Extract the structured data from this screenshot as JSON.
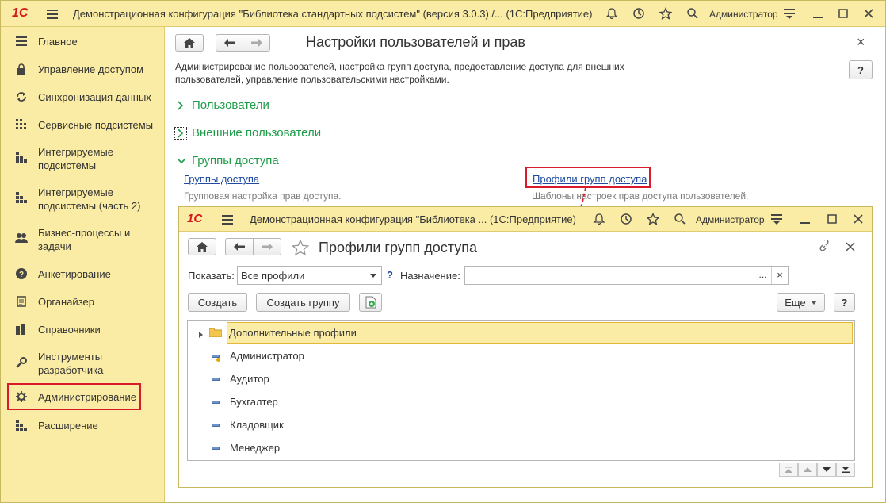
{
  "app": {
    "logo": "1С",
    "title": "Демонстрационная конфигурация \"Библиотека стандартных подсистем\" (версия 3.0.3) /...  (1С:Предприятие)",
    "user": "Администратор"
  },
  "sidebar": {
    "items": [
      {
        "label": "Главное",
        "icon": "menu-icon"
      },
      {
        "label": "Управление доступом",
        "icon": "lock-icon"
      },
      {
        "label": "Синхронизация данных",
        "icon": "sync-icon"
      },
      {
        "label": "Сервисные подсистемы",
        "icon": "grid-icon"
      },
      {
        "label": "Интегрируемые подсистемы",
        "icon": "blocks-icon"
      },
      {
        "label": "Интегрируемые подсистемы (часть 2)",
        "icon": "blocks-icon"
      },
      {
        "label": "Бизнес-процессы и задачи",
        "icon": "people-icon"
      },
      {
        "label": "Анкетирование",
        "icon": "question-icon"
      },
      {
        "label": "Органайзер",
        "icon": "notepad-icon"
      },
      {
        "label": "Справочники",
        "icon": "books-icon"
      },
      {
        "label": "Инструменты разработчика",
        "icon": "wrench-icon"
      },
      {
        "label": "Администрирование",
        "icon": "gear-icon"
      },
      {
        "label": "Расширение",
        "icon": "blocks-icon"
      }
    ]
  },
  "main": {
    "title": "Настройки пользователей и прав",
    "description": "Администрирование пользователей, настройка групп доступа, предоставление доступа для внешних пользователей, управление пользовательскими настройками.",
    "help": "?",
    "close": "×",
    "groups": [
      {
        "label": "Пользователи"
      },
      {
        "label": "Внешние пользователи"
      },
      {
        "label": "Группы доступа"
      }
    ],
    "links": [
      {
        "label": "Группы доступа",
        "hint": "Групповая настройка прав доступа."
      },
      {
        "label": "Профили групп доступа",
        "hint": "Шаблоны настроек прав доступа пользователей."
      }
    ]
  },
  "subwindow": {
    "title": "Демонстрационная конфигурация \"Библиотека ...  (1С:Предприятие)",
    "user": "Администратор",
    "form_title": "Профили групп доступа",
    "show_label": "Показать:",
    "show_value": "Все профили",
    "purpose_label": "Назначение:",
    "purpose_value": "",
    "help_mark": "?",
    "buttons": {
      "create": "Создать",
      "create_group": "Создать группу",
      "more": "Еще",
      "help": "?",
      "pick": "...",
      "clear": "×"
    },
    "rows": [
      {
        "label": "Дополнительные профили",
        "type": "folder"
      },
      {
        "label": "Администратор",
        "type": "admin"
      },
      {
        "label": "Аудитор",
        "type": "item"
      },
      {
        "label": "Бухгалтер",
        "type": "item"
      },
      {
        "label": "Кладовщик",
        "type": "item"
      },
      {
        "label": "Менеджер",
        "type": "item"
      }
    ]
  },
  "colors": {
    "accent": "#fbeca5",
    "group_green": "#1f9c4a",
    "link_blue": "#1e4aa0",
    "highlight_red": "#d81a2a"
  }
}
